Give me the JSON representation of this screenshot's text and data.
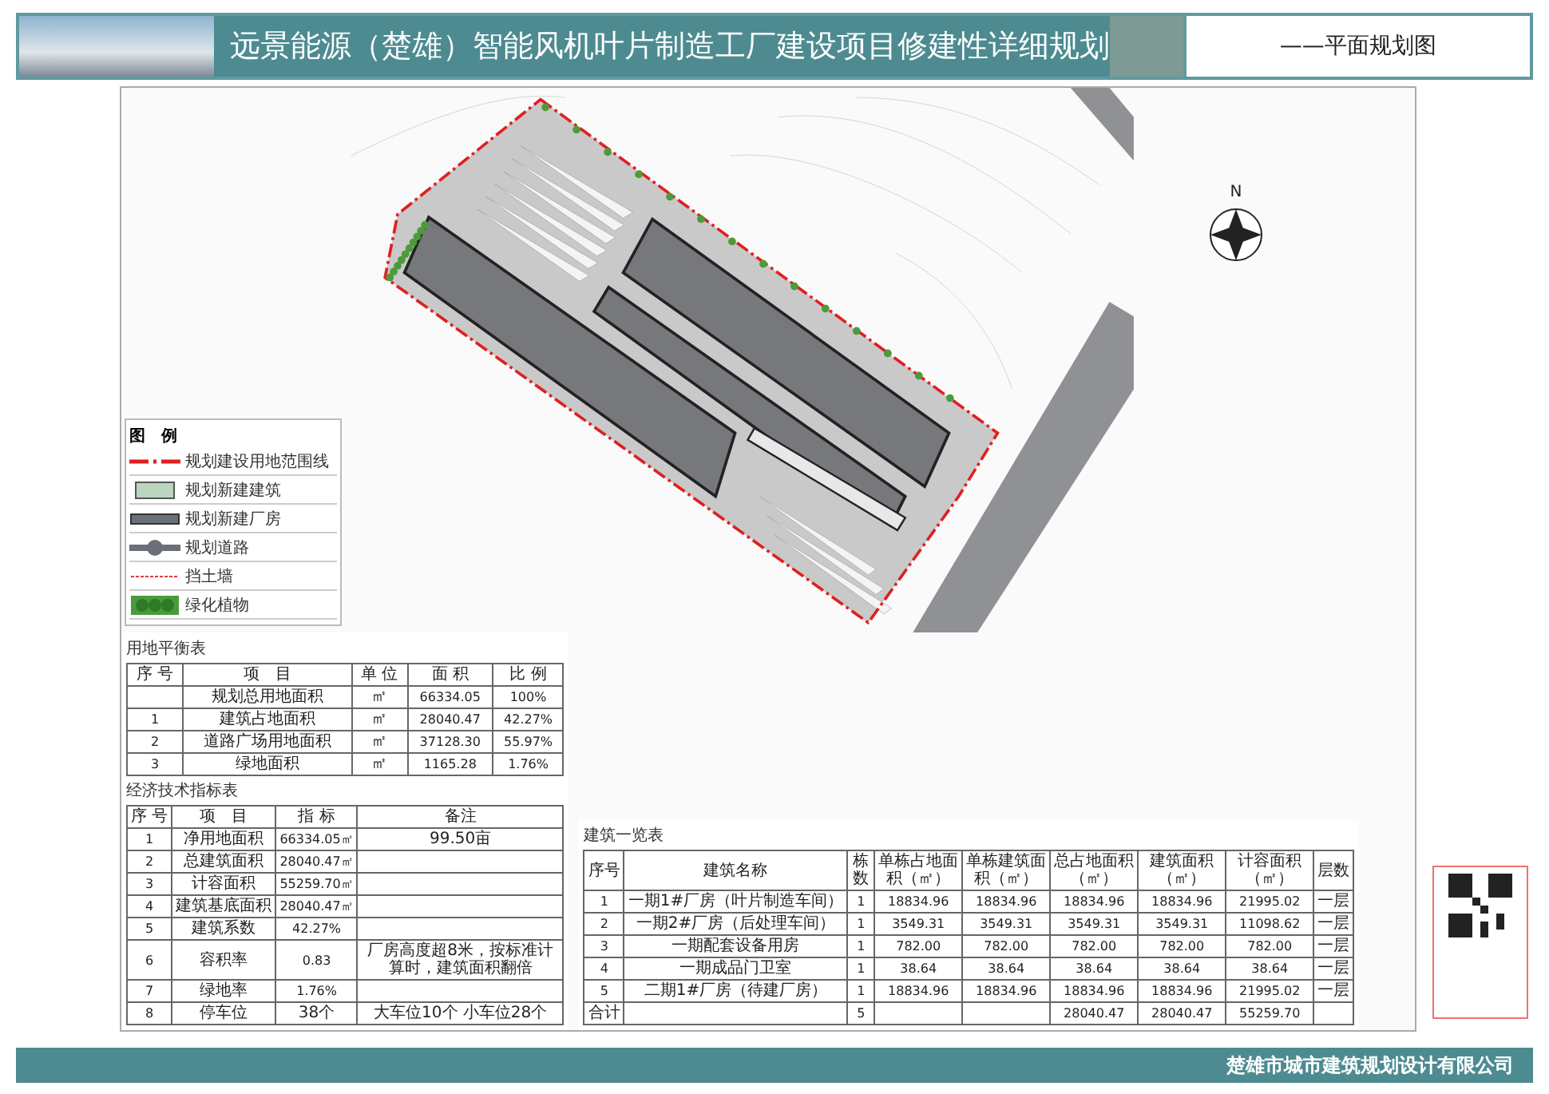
{
  "header": {
    "title": "远景能源（楚雄）智能风机叶片制造工厂建设项目修建性详细规划",
    "subtitle": "——平面规划图"
  },
  "compass": {
    "label": "N"
  },
  "legend": {
    "title": "图　例",
    "items": [
      {
        "kind": "boundary",
        "label": "规划建设用地范围线"
      },
      {
        "kind": "new-building",
        "label": "规划新建建筑"
      },
      {
        "kind": "factory",
        "label": "规划新建厂房"
      },
      {
        "kind": "road",
        "label": "规划道路"
      },
      {
        "kind": "retaining-wall",
        "label": "挡土墙"
      },
      {
        "kind": "greenery",
        "label": "绿化植物"
      }
    ]
  },
  "land_use_table": {
    "title": "用地平衡表",
    "columns": [
      "序 号",
      "项　目",
      "单 位",
      "面 积",
      "比 例"
    ],
    "rows": [
      [
        "",
        "规划总用地面积",
        "㎡",
        "66334.05",
        "100%"
      ],
      [
        "1",
        "建筑占地面积",
        "㎡",
        "28040.47",
        "42.27%"
      ],
      [
        "2",
        "道路广场用地面积",
        "㎡",
        "37128.30",
        "55.97%"
      ],
      [
        "3",
        "绿地面积",
        "㎡",
        "1165.28",
        "1.76%"
      ]
    ]
  },
  "indicators_table": {
    "title": "经济技术指标表",
    "columns": [
      "序 号",
      "项　目",
      "指 标",
      "备注"
    ],
    "rows": [
      [
        "1",
        "净用地面积",
        "66334.05㎡",
        "99.50亩"
      ],
      [
        "2",
        "总建筑面积",
        "28040.47㎡"
      ],
      [
        "3",
        "计容面积",
        "55259.70㎡"
      ],
      [
        "4",
        "建筑基底面积",
        "28040.47㎡"
      ],
      [
        "5",
        "建筑系数",
        "42.27%"
      ],
      [
        "6",
        "容积率",
        "0.83",
        "厂房高度超8米，按标准计算时，建筑面积翻倍"
      ],
      [
        "7",
        "绿地率",
        "1.76%"
      ],
      [
        "8",
        "停车位",
        "38个",
        "大车位10个 小车位28个"
      ]
    ]
  },
  "buildings_table": {
    "title": "建筑一览表",
    "columns": [
      "序号",
      "建筑名称",
      "栋数",
      "单栋占地面积（㎡）",
      "单栋建筑面积（㎡）",
      "总占地面积（㎡）",
      "建筑面积（㎡）",
      "计容面积（㎡）",
      "层数"
    ],
    "rows": [
      [
        "1",
        "一期1#厂房（叶片制造车间）",
        "1",
        "18834.96",
        "18834.96",
        "18834.96",
        "18834.96",
        "21995.02",
        "一层"
      ],
      [
        "2",
        "一期2#厂房（后处理车间）",
        "1",
        "3549.31",
        "3549.31",
        "3549.31",
        "3549.31",
        "11098.62",
        "一层"
      ],
      [
        "3",
        "一期配套设备用房",
        "1",
        "782.00",
        "782.00",
        "782.00",
        "782.00",
        "782.00",
        "一层"
      ],
      [
        "4",
        "一期成品门卫室",
        "1",
        "38.64",
        "38.64",
        "38.64",
        "38.64",
        "38.64",
        "一层"
      ],
      [
        "5",
        "二期1#厂房（待建厂房）",
        "1",
        "18834.96",
        "18834.96",
        "18834.96",
        "18834.96",
        "21995.02",
        "一层"
      ],
      [
        "合计",
        "",
        "5",
        "",
        "",
        "28040.47",
        "28040.47",
        "55259.70",
        ""
      ]
    ]
  },
  "footer": {
    "company": "楚雄市城市建筑规划设计有限公司"
  }
}
